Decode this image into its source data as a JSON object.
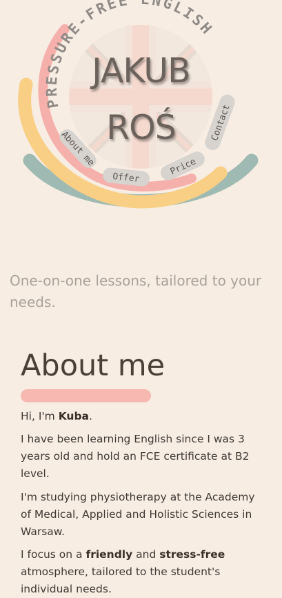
{
  "brand": {
    "arc_title": "PRESSURE-FREE ENGLISH",
    "name_line1": "JAKUB",
    "name_line2": "ROŚ"
  },
  "nav": {
    "about": "About me",
    "offer": "Offer",
    "price": "Price",
    "contact": "Contact"
  },
  "tagline": "One-on-one lessons, tailored to your needs.",
  "about": {
    "title": "About me",
    "p1_pre": "Hi, I'm ",
    "p1_name": "Kuba",
    "p1_post": ".",
    "p2": "I have been learning English since I was 3 years old and hold an FCE certificate at B2 level.",
    "p3": "I'm studying physiotherapy at the Academy of Medical, Applied and Holistic Sciences in Warsaw.",
    "p4_a": "I focus on a ",
    "p4_b": "friendly",
    "p4_c": " and ",
    "p4_d": "stress-free",
    "p4_e": " atmosphere, tailored to the student's individual needs."
  },
  "colors": {
    "background": "#f7ede3",
    "arc_pink": "#f6b0ab",
    "arc_yellow": "#f8cf85",
    "arc_teal": "#9fbab2",
    "flag": "#dccfc6"
  }
}
